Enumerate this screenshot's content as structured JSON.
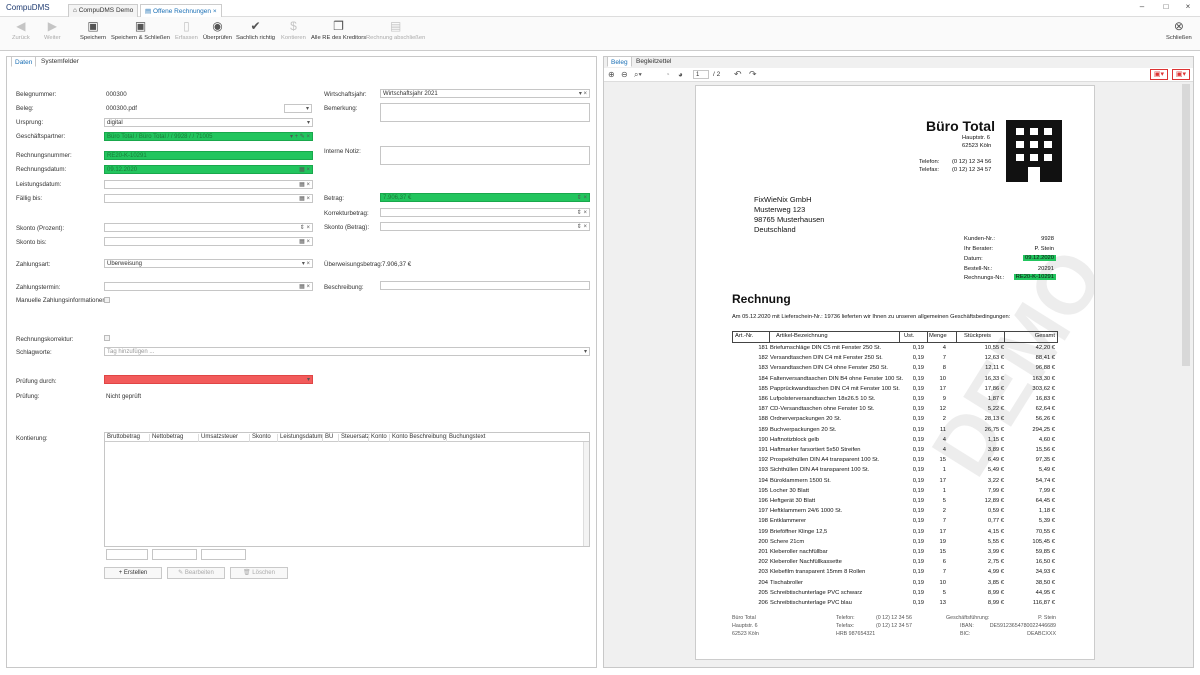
{
  "app": {
    "title": "CompuDMS",
    "tabs": [
      {
        "label": "CompuDMS Demo"
      },
      {
        "label": "Offene Rechnungen"
      }
    ]
  },
  "toolbar": {
    "back": "Zurück",
    "forward": "Weiter",
    "save": "Speichern",
    "save_close": "Speichern & Schließen",
    "capture": "Erfassen",
    "review": "Überprüfen",
    "approve": "Sachlich richtig",
    "accounts": "Kontieren",
    "all_invoices": "Alle RE des Kreditors",
    "complete": "Rechnung abschließen",
    "close": "Schließen"
  },
  "left": {
    "tabs": [
      "Daten",
      "Systemfelder"
    ],
    "fields": {
      "belegnummer_label": "Belegnummer:",
      "belegnummer": "000300",
      "beleg_label": "Beleg:",
      "beleg": "000300.pdf",
      "ursprung_label": "Ursprung:",
      "ursprung": "digital",
      "partner_label": "Geschäftspartner:",
      "partner": "Büro Total / Büro Total / / 9928 / / 71005",
      "rechnungsnummer_label": "Rechnungsnummer:",
      "rechnungsnummer": "RE20-K-10291",
      "rechnungsdatum_label": "Rechnungsdatum:",
      "rechnungsdatum": "09.12.2020",
      "leistungsdatum_label": "Leistungsdatum:",
      "faellig_label": "Fällig bis:",
      "skonto_prozent_label": "Skonto (Prozent):",
      "skonto_bis_label": "Skonto bis:",
      "zahlungsart_label": "Zahlungsart:",
      "zahlungsart": "Überweisung",
      "zahlungstermin_label": "Zahlungstermin:",
      "manuelle_label": "Manuelle Zahlungsinformationen:",
      "korrektur_label": "Rechnungskorrektur:",
      "schlagworte_label": "Schlagworte:",
      "schlagworte_ph": "Tag hinzufügen ...",
      "pruefung_durch_label": "Prüfung durch:",
      "pruefung_label": "Prüfung:",
      "pruefung": "Nicht geprüft",
      "kontierung_label": "Kontierung:",
      "wirtschaftsjahr_label": "Wirtschaftsjahr:",
      "wirtschaftsjahr": "Wirtschaftsjahr 2021",
      "bemerkung_label": "Bemerkung:",
      "notiz_label": "Interne Notiz:",
      "betrag_label": "Betrag:",
      "betrag": "7.906,37 €",
      "korrekturbetrag_label": "Korrekturbetrag:",
      "skonto_betrag_label": "Skonto (Betrag):",
      "ueberweisung_label": "Überweisungsbetrag:",
      "ueberweisung": "7.906,37 €",
      "beschreibung_label": "Beschreibung:"
    },
    "grid_headers": [
      "Bruttobetrag",
      "Nettobetrag",
      "Umsatzsteuer",
      "Skonto",
      "Leistungsdatum",
      "BU",
      "Steuersatz",
      "Konto",
      "Konto Beschreibung",
      "Buchungstext"
    ],
    "buttons": {
      "create": "Erstellen",
      "edit": "Bearbeiten",
      "delete": "Löschen"
    }
  },
  "right": {
    "tabs": [
      "Beleg",
      "Begleitzettel"
    ],
    "page_current": "1",
    "page_total": "/ 2"
  },
  "document": {
    "company": "Büro Total",
    "company_addr1": "Hauptstr. 6",
    "company_addr2": "62523 Köln",
    "tel_label": "Telefon:",
    "tel": "(0 12) 12 34 56",
    "fax_label": "Telefax:",
    "fax": "(0 12) 12 34 57",
    "recipient": [
      "FixWieNix GmbH",
      "Musterweg 123",
      "98765 Musterhausen",
      "Deutschland"
    ],
    "meta": [
      {
        "label": "Kunden-Nr.:",
        "value": "9928",
        "hl": false
      },
      {
        "label": "Ihr Berater:",
        "value": "P. Stein",
        "hl": false
      },
      {
        "label": "Datum:",
        "value": "09.12.2020",
        "hl": true
      },
      {
        "label": "Bestell-Nr.:",
        "value": "20291",
        "hl": false
      },
      {
        "label": "Rechnungs-Nr.:",
        "value": "RE20-K-10291",
        "hl": true
      }
    ],
    "heading": "Rechnung",
    "intro": "Am 05.12.2020 mit Lieferschein-Nr.: 19736 lieferten wir Ihnen zu unseren allgemeinen Geschäftsbedingungen:",
    "watermark": "DEMO",
    "table_headers": [
      "Art.-Nr.",
      "Artikel-Bezeichnung",
      "Ust.",
      "Menge",
      "Stückpreis",
      "Gesamt"
    ],
    "rows": [
      [
        "181",
        "Briefumschläge DIN C5 mit Fenster 250 St.",
        "0,19",
        "4",
        "10,55 €",
        "42,20 €"
      ],
      [
        "182",
        "Versandtaschen DIN C4 mit Fenster 250 St.",
        "0,19",
        "7",
        "12,63 €",
        "88,41 €"
      ],
      [
        "183",
        "Versandtaschen DIN C4 ohne Fenster 250 St.",
        "0,19",
        "8",
        "12,11 €",
        "96,88 €"
      ],
      [
        "184",
        "Faltenversandtaschen DIN B4 ohne Fenster 100 St.",
        "0,19",
        "10",
        "16,33 €",
        "163,30 €"
      ],
      [
        "185",
        "Papprückwandtaschen DIN C4 mit Fenster 100 St.",
        "0,19",
        "17",
        "17,86 €",
        "303,62 €"
      ],
      [
        "186",
        "Lufpolsterversandtaschen 18x26.5 10 St.",
        "0,19",
        "9",
        "1,87 €",
        "16,83 €"
      ],
      [
        "187",
        "CD-Versandtaschen ohne Fenster 10 St.",
        "0,19",
        "12",
        "5,22 €",
        "62,64 €"
      ],
      [
        "188",
        "Ordnerverpackungen 20 St.",
        "0,19",
        "2",
        "28,13 €",
        "56,26 €"
      ],
      [
        "189",
        "Buchverpackungen 20 St.",
        "0,19",
        "11",
        "26,75 €",
        "294,25 €"
      ],
      [
        "190",
        "Haftnotizblock gelb",
        "0,19",
        "4",
        "1,15 €",
        "4,60 €"
      ],
      [
        "191",
        "Haftmarker farsortiert 5x50 Streifen",
        "0,19",
        "4",
        "3,89 €",
        "15,56 €"
      ],
      [
        "192",
        "Prospekthüllen DIN A4 transparent 100 St.",
        "0,19",
        "15",
        "6,49 €",
        "97,35 €"
      ],
      [
        "193",
        "Sichthüllen DIN A4 transparent 100 St.",
        "0,19",
        "1",
        "5,49 €",
        "5,49 €"
      ],
      [
        "194",
        "Büroklammern 1500 St.",
        "0,19",
        "17",
        "3,22 €",
        "54,74 €"
      ],
      [
        "195",
        "Locher 30 Blatt",
        "0,19",
        "1",
        "7,99 €",
        "7,99 €"
      ],
      [
        "196",
        "Heftgerät 30 Blatt",
        "0,19",
        "5",
        "12,89 €",
        "64,45 €"
      ],
      [
        "197",
        "Heftklammern 24/6 1000 St.",
        "0,19",
        "2",
        "0,59 €",
        "1,18 €"
      ],
      [
        "198",
        "Entklammerer",
        "0,19",
        "7",
        "0,77 €",
        "5,39 €"
      ],
      [
        "199",
        "Brieföffner Klinge 12,5",
        "0,19",
        "17",
        "4,15 €",
        "70,55 €"
      ],
      [
        "200",
        "Schere 21cm",
        "0,19",
        "19",
        "5,55 €",
        "105,45 €"
      ],
      [
        "201",
        "Kleberoller nachfüllbar",
        "0,19",
        "15",
        "3,99 €",
        "59,85 €"
      ],
      [
        "202",
        "Kleberoller Nachfüllkassette",
        "0,19",
        "6",
        "2,75 €",
        "16,50 €"
      ],
      [
        "203",
        "Klebefilm transparent 15mm 8 Rollen",
        "0,19",
        "7",
        "4,99 €",
        "34,93 €"
      ],
      [
        "204",
        "Tischabroller",
        "0,19",
        "10",
        "3,85 €",
        "38,50 €"
      ],
      [
        "205",
        "Schreibtischunterlage PVC schwarz",
        "0,19",
        "5",
        "8,99 €",
        "44,95 €"
      ],
      [
        "206",
        "Schreibtischunterlage PVC blau",
        "0,19",
        "13",
        "8,99 €",
        "116,87 €"
      ]
    ],
    "footer": {
      "col1": [
        "Büro Total",
        "Hauptstr. 6",
        "62523 Köln"
      ],
      "col2_labels": [
        "Telefon:",
        "Telefax:",
        "HRB 987654321"
      ],
      "col2_values": [
        "(0 12) 12 34 56",
        "(0 12) 12 34 57"
      ],
      "col3_labels": [
        "Geschäftsführung:",
        "IBAN:",
        "BIC:"
      ],
      "col3_values": [
        "P. Stein",
        "DE59123654780022446689",
        "DEABCXXX"
      ]
    }
  }
}
